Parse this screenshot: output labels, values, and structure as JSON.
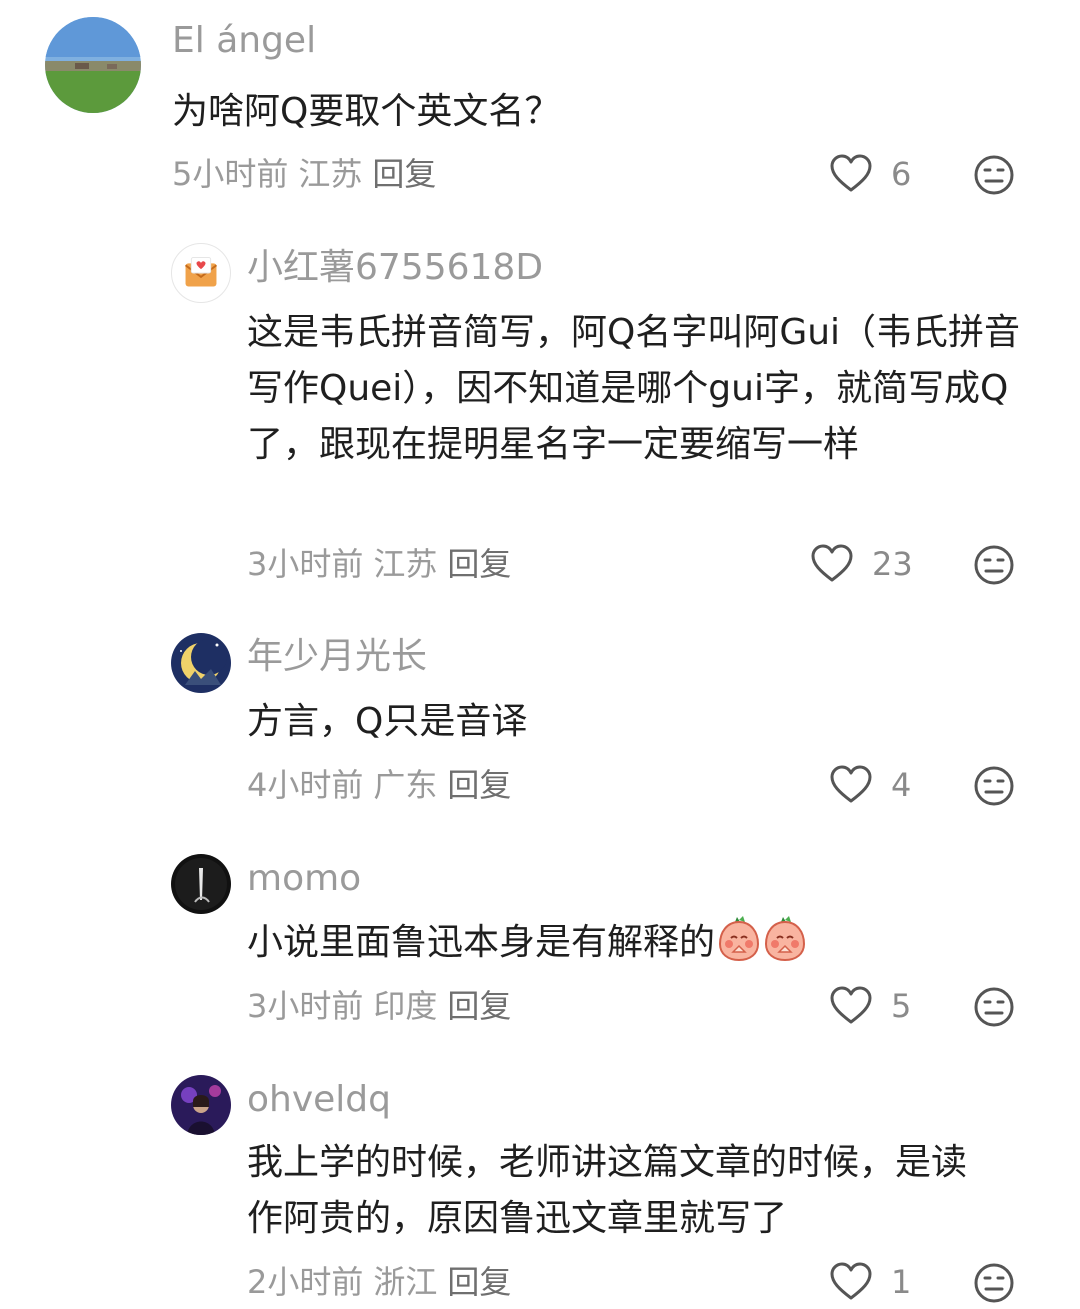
{
  "comments": [
    {
      "username": "El  ángel",
      "text": "为啥阿Q要取个英文名？",
      "time": "5小时前",
      "location": "江苏",
      "reply_label": "回复",
      "likes": "6",
      "avatar_icon": "landscape-photo"
    },
    {
      "username": "小红薯6755618D",
      "text": "这是韦氏拼音简写，阿Q名字叫阿Gui（韦氏拼音写作Quei），因不知道是哪个gui字，就简写成Q了，跟现在提明星名字一定要缩写一样",
      "time": "3小时前",
      "location": "江苏",
      "reply_label": "回复",
      "likes": "23",
      "avatar_icon": "envelope-heart-icon"
    },
    {
      "username": "年少月光长",
      "text": "方言，Q只是音译",
      "time": "4小时前",
      "location": "广东",
      "reply_label": "回复",
      "likes": "4",
      "avatar_icon": "moon-night-photo"
    },
    {
      "username": "momo",
      "text": "小说里面鲁迅本身是有解释的",
      "time": "3小时前",
      "location": "印度",
      "reply_label": "回复",
      "likes": "5",
      "avatar_icon": "dark-figure-photo",
      "text_emojis": [
        "peach-praying-emoji",
        "peach-praying-emoji"
      ]
    },
    {
      "username": "ohveldq",
      "text": "我上学的时候，老师讲这篇文章的时候，是读作阿贵的，原因鲁迅文章里就写了",
      "time": "2小时前",
      "location": "浙江",
      "reply_label": "回复",
      "likes": "1",
      "avatar_icon": "concert-photo"
    }
  ],
  "colors": {
    "text": "#1f1f1f",
    "muted": "#9a9a9a",
    "icon": "#555555"
  }
}
